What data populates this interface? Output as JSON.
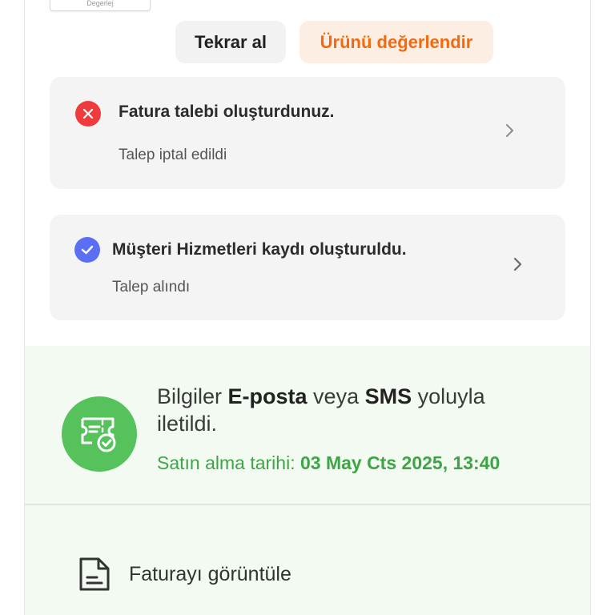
{
  "thumbnail": {
    "caption": "Degerlej"
  },
  "actions": {
    "rebuy_label": "Tekrar al",
    "review_label": "Ürünü değerlendir"
  },
  "cards": {
    "invoice": {
      "title": "Fatura talebi oluşturdunuz.",
      "status": "Talep iptal edildi",
      "icon": "close-icon",
      "icon_color": "#ef3b3b"
    },
    "support": {
      "title": "Müşteri Hizmetleri kaydı oluşturuldu.",
      "status": "Talep alındı",
      "icon": "check-icon",
      "icon_color": "#5b6ff5"
    }
  },
  "delivery": {
    "icon": "ticket-check-icon",
    "text_prefix": "Bilgiler ",
    "text_email": "E-posta",
    "text_middle": " veya ",
    "text_sms": "SMS",
    "text_suffix": " yoluyla iletildi.",
    "purchase_label": "Satın alma tarihi: ",
    "purchase_date": "03 May Cts 2025, 13:40",
    "accent_color": "#3fa447"
  },
  "invoice_link": {
    "label": "Faturayı görüntüle",
    "icon": "document-icon"
  },
  "colors": {
    "brand_orange": "#f26a10",
    "success_green": "#56c25c",
    "error_red": "#ef3b3b",
    "info_blue": "#5b6ff5"
  }
}
